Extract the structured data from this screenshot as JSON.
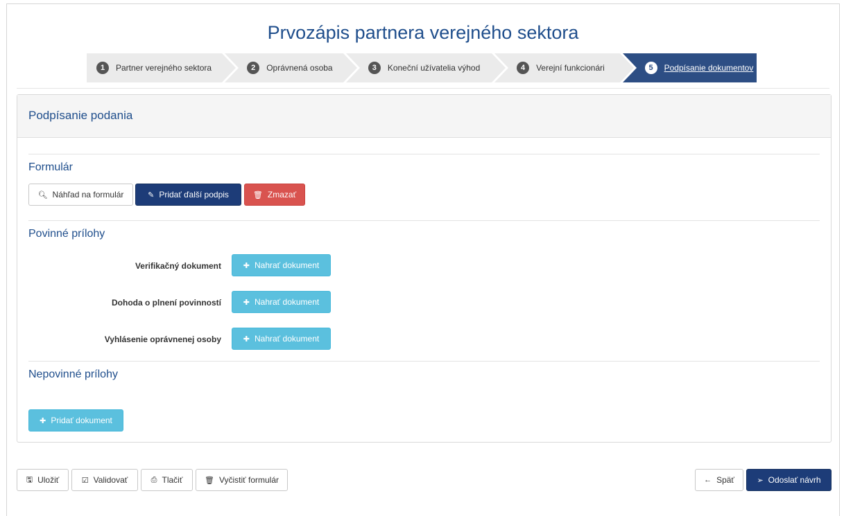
{
  "page_title": "Prvozápis partnera verejného sektora",
  "wizard": {
    "steps": [
      {
        "number": "1",
        "label": "Partner verejného sektora"
      },
      {
        "number": "2",
        "label": "Oprávnená osoba"
      },
      {
        "number": "3",
        "label": "Koneční užívatelia výhod"
      },
      {
        "number": "4",
        "label": "Verejní funkcionári"
      },
      {
        "number": "5",
        "label": "Podpísanie dokumentov"
      }
    ],
    "active_step": "5"
  },
  "panel": {
    "title": "Podpísanie podania",
    "formular": {
      "title": "Formulár",
      "preview_button": "Náhľad na formulár",
      "add_signature_button": "Pridať ďalší podpis",
      "delete_button": "Zmazať"
    },
    "required_attachments": {
      "title": "Povinné prílohy",
      "items": [
        {
          "label": "Verifikačný dokument",
          "button": "Nahrať dokument"
        },
        {
          "label": "Dohoda o plnení povinností",
          "button": "Nahrať dokument"
        },
        {
          "label": "Vyhlásenie oprávnenej osoby",
          "button": "Nahrať dokument"
        }
      ]
    },
    "optional_attachments": {
      "title": "Nepovinné prílohy",
      "add_button": "Pridať dokument"
    }
  },
  "footer": {
    "save": "Uložiť",
    "validate": "Validovať",
    "print": "Tlačiť",
    "clear": "Vyčistiť formulár",
    "back": "Späť",
    "submit": "Odoslať návrh"
  },
  "colors": {
    "accent": "#1f4e8c",
    "primary_button": "#1d3c78",
    "danger_button": "#d9534f",
    "info_button": "#5bc0de",
    "active_step": "#2d4e84"
  },
  "icons": {
    "preview": "magnifier-plus-icon",
    "add_signature": "edit-icon",
    "delete": "trash-icon",
    "upload": "plus-icon",
    "save": "floppy-icon",
    "validate": "check-square-icon",
    "print": "printer-icon",
    "clear": "trash-icon",
    "back": "arrow-left-icon",
    "submit": "paper-plane-icon"
  }
}
